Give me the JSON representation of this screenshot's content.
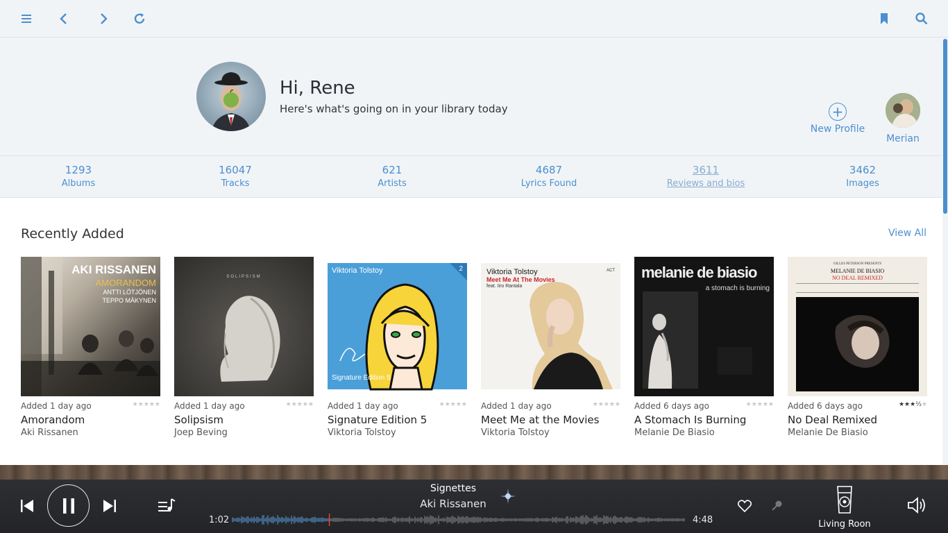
{
  "toolbar": {
    "icons": [
      "menu-icon",
      "back-icon",
      "forward-icon",
      "refresh-icon",
      "bookmark-icon",
      "search-icon"
    ],
    "accent": "#4b8fce"
  },
  "hero": {
    "greeting": "Hi, Rene",
    "subtitle": "Here's what's going on in your library today",
    "new_profile_label": "New Profile",
    "other_profile_name": "Merian"
  },
  "stats": [
    {
      "value": "1293",
      "label": "Albums"
    },
    {
      "value": "16047",
      "label": "Tracks"
    },
    {
      "value": "621",
      "label": "Artists"
    },
    {
      "value": "4687",
      "label": "Lyrics Found"
    },
    {
      "value": "3611",
      "label": "Reviews and bios"
    },
    {
      "value": "3462",
      "label": "Images"
    }
  ],
  "recent": {
    "title": "Recently Added",
    "view_all": "View All",
    "albums": [
      {
        "added": "Added 1 day ago",
        "title": "Amorandom",
        "artist": "Aki Rissanen",
        "rating": 0,
        "cover_text": [
          "AKI RISSANEN",
          "AMORANDOM",
          "ANTTI LÖTJÖNEN",
          "TEPPO MÄKYNEN"
        ]
      },
      {
        "added": "Added 1 day ago",
        "title": "Solipsism",
        "artist": "Joep Beving",
        "rating": 0,
        "cover_text": [
          "SOLIPSISM"
        ]
      },
      {
        "added": "Added 1 day ago",
        "title": "Signature Edition 5",
        "artist": "Viktoria Tolstoy",
        "rating": 0,
        "cover_text": [
          "Viktoria Tolstoy",
          "Signature Edition 5",
          "2"
        ]
      },
      {
        "added": "Added 1 day ago",
        "title": "Meet Me at the Movies",
        "artist": "Viktoria Tolstoy",
        "rating": 0,
        "cover_text": [
          "Viktoria Tolstoy",
          "Meet Me At The Movies",
          "feat. Iiro Rantala",
          "ACT"
        ]
      },
      {
        "added": "Added 6 days ago",
        "title": "A Stomach Is Burning",
        "artist": "Melanie De Biasio",
        "rating": 0,
        "cover_text": [
          "melanie de biasio",
          "a stomach is burning"
        ]
      },
      {
        "added": "Added 6 days ago",
        "title": "No Deal Remixed",
        "artist": "Melanie De Biasio",
        "rating": 3.5,
        "cover_text": [
          "GILLES PETERSON PRESENTS",
          "MELANIE DE BIASIO",
          "NO DEAL REMIXED"
        ]
      }
    ]
  },
  "player": {
    "track": "Signettes",
    "artist": "Aki Rissanen",
    "elapsed": "1:02",
    "duration": "4:48",
    "progress": 0.215,
    "zone": "Living Roon",
    "icons": [
      "previous-icon",
      "pause-icon",
      "next-icon",
      "queue-icon",
      "heart-icon",
      "radio-icon",
      "zone-speaker-icon",
      "volume-icon"
    ]
  }
}
